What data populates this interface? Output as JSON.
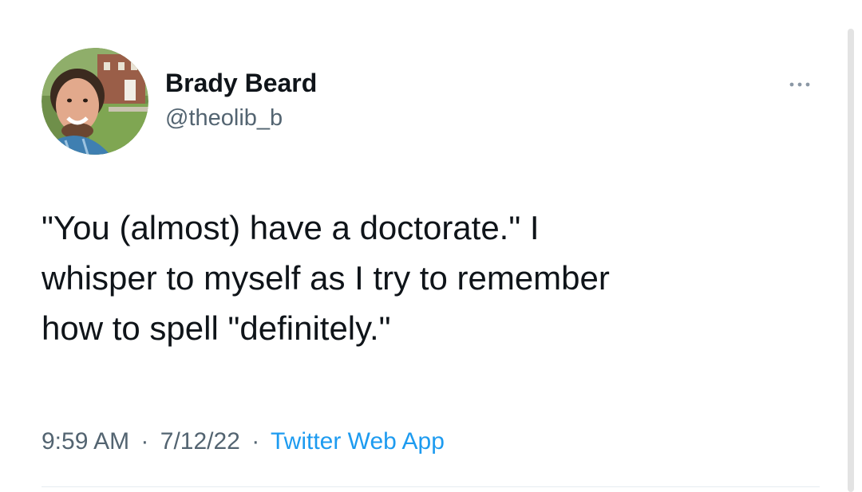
{
  "tweet": {
    "author": {
      "display_name": "Brady Beard",
      "handle": "@theolib_b",
      "avatar_icon": "profile-photo"
    },
    "more_icon": "ellipsis-icon",
    "text_lines": [
      "\"You (almost) have a doctorate.\" I",
      "whisper to myself as I try to remember",
      "how to spell \"definitely.\""
    ],
    "time": "9:59 AM",
    "date": "7/12/22",
    "separator": "·",
    "source": "Twitter Web App"
  },
  "colors": {
    "text_primary": "#0f1419",
    "text_secondary": "#536471",
    "link": "#1d9bf0",
    "divider": "#e6ecf0"
  }
}
